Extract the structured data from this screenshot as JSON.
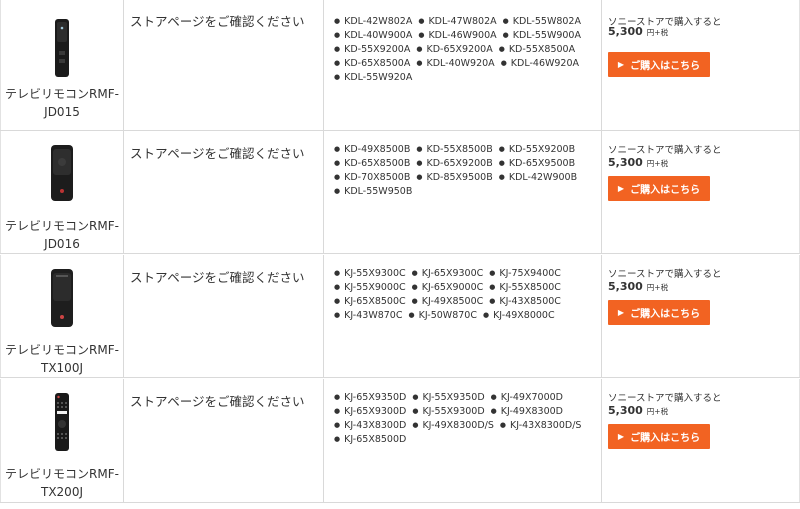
{
  "rows": [
    {
      "model_line1": "テレビリモコンRMF-",
      "model_line2": "JD015",
      "store_text": "ストアページをご確認ください",
      "tv_models": [
        "KDL-42W802A",
        "KDL-47W802A",
        "KDL-55W802A",
        "KDL-40W900A",
        "KDL-46W900A",
        "KDL-55W900A",
        "KD-55X9200A",
        "KD-65X9200A",
        "KD-55X8500A",
        "KD-65X8500A",
        "KDL-40W920A",
        "KDL-46W920A",
        "KDL-55W920A"
      ],
      "buy_text": "ソニーストアで購入すると",
      "price": "5,300",
      "price_unit": "円+税",
      "button_label": "ご購入はこちら",
      "button_arrow": "▶"
    },
    {
      "model_line1": "テレビリモコンRMF-",
      "model_line2": "JD016",
      "store_text": "ストアページをご確認ください",
      "tv_models": [
        "KD-49X8500B",
        "KD-55X8500B",
        "KD-55X9200B",
        "KD-65X8500B",
        "KD-65X9200B",
        "KD-65X9500B",
        "KD-70X8500B",
        "KD-85X9500B",
        "KDL-42W900B",
        "KDL-55W950B"
      ],
      "buy_text": "ソニーストアで購入すると",
      "price": "5,300",
      "price_unit": "円+税",
      "button_label": "ご購入はこちら",
      "button_arrow": "▶"
    },
    {
      "model_line1": "テレビリモコンRMF-",
      "model_line2": "TX100J",
      "store_text": "ストアページをご確認ください",
      "tv_models": [
        "KJ-55X9300C",
        "KJ-65X9300C",
        "KJ-75X9400C",
        "KJ-55X9000C",
        "KJ-65X9000C",
        "KJ-55X8500C",
        "KJ-65X8500C",
        "KJ-49X8500C",
        "KJ-43X8500C",
        "KJ-43W870C",
        "KJ-50W870C",
        "KJ-49X8000C"
      ],
      "buy_text": "ソニーストアで購入すると",
      "price": "5,300",
      "price_unit": "円+税",
      "button_label": "ご購入はこちら",
      "button_arrow": "▶"
    },
    {
      "model_line1": "テレビリモコンRMF-",
      "model_line2": "TX200J",
      "store_text": "ストアページをご確認ください",
      "tv_models": [
        "KJ-65X9350D",
        "KJ-55X9350D",
        "KJ-49X7000D",
        "KJ-65X9300D",
        "KJ-55X9300D",
        "KJ-49X8300D",
        "KJ-43X8300D",
        "KJ-49X8300D/S",
        "KJ-43X8300D/S",
        "KJ-65X8500D"
      ],
      "buy_text": "ソニーストアで購入すると",
      "price": "5,300",
      "price_unit": "円+税",
      "button_label": "ご購入はこちら",
      "button_arrow": "▶"
    }
  ],
  "colors": {
    "button_bg": "#f26322",
    "border": "#d9d9d9",
    "text": "#333333"
  },
  "icons": [
    "remote-jd015-icon",
    "remote-jd016-icon",
    "remote-tx100j-icon",
    "remote-tx200j-icon"
  ]
}
